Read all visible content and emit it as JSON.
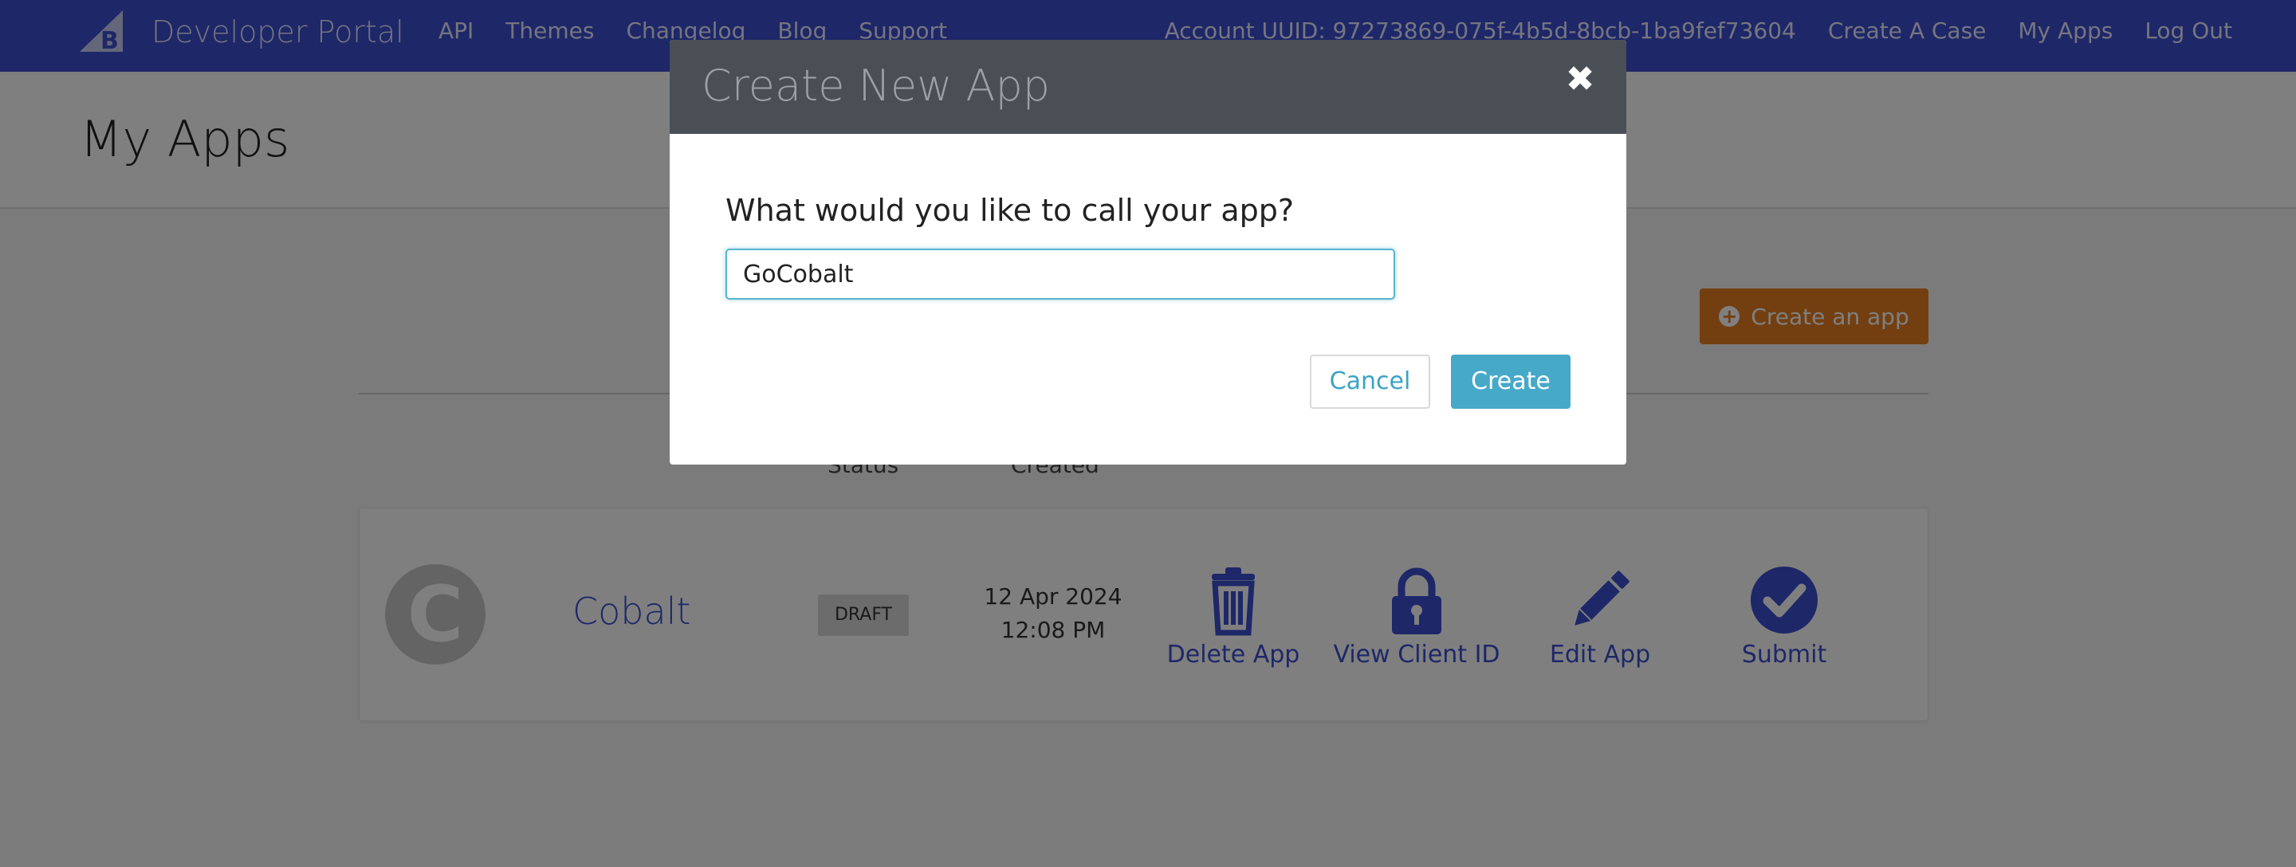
{
  "brand": {
    "name": "Developer Portal",
    "logo_icon": "bigcommerce-logo-icon"
  },
  "nav": {
    "left": [
      "API",
      "Themes",
      "Changelog",
      "Blog",
      "Support"
    ],
    "account_uuid": "Account UUID: 97273869-075f-4b5d-8bcb-1ba9fef73604",
    "right": [
      "Create A Case",
      "My Apps",
      "Log Out"
    ]
  },
  "page": {
    "title": "My Apps",
    "create_app_label": "Create an app"
  },
  "table": {
    "headers": {
      "status": "Status",
      "created": "Created"
    }
  },
  "app": {
    "avatar_letter": "C",
    "name": "Cobalt",
    "status": "DRAFT",
    "created_date": "12 Apr 2024",
    "created_time": "12:08 PM",
    "actions": [
      {
        "label": "Delete App",
        "icon": "trash-icon"
      },
      {
        "label": "View Client ID",
        "icon": "lock-icon"
      },
      {
        "label": "Edit App",
        "icon": "pencil-icon"
      },
      {
        "label": "Submit",
        "icon": "check-circle-icon"
      }
    ]
  },
  "modal": {
    "title": "Create New App",
    "close_icon": "close-icon",
    "question": "What would you like to call your app?",
    "input_value": "GoCobalt",
    "cancel_label": "Cancel",
    "create_label": "Create"
  },
  "colors": {
    "brand": "#3c4fd1",
    "accent": "#e67e22",
    "primary_button": "#47a9c8",
    "modal_header": "#4a4f55"
  }
}
